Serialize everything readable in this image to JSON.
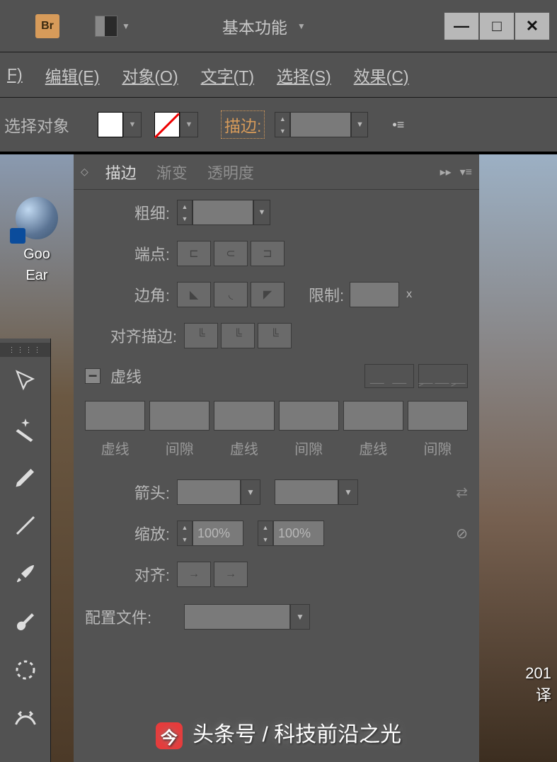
{
  "titlebar": {
    "bridge_label": "Br",
    "workspace_label": "基本功能"
  },
  "menu": {
    "edit": "编辑(E)",
    "object": "对象(O)",
    "type": "文字(T)",
    "select": "选择(S)",
    "effect": "效果(C)"
  },
  "optbar": {
    "select_label": "选择对象",
    "stroke_label": "描边:"
  },
  "panel": {
    "tabs": {
      "stroke": "描边",
      "gradient": "渐变",
      "transparency": "透明度"
    },
    "weight_label": "粗细:",
    "cap_label": "端点:",
    "corner_label": "边角:",
    "limit_label": "限制:",
    "limit_suffix": "x",
    "align_stroke_label": "对齐描边:",
    "dashed_label": "虚线",
    "dash_cols": [
      "虚线",
      "间隙",
      "虚线",
      "间隙",
      "虚线",
      "间隙"
    ],
    "arrow_label": "箭头:",
    "scale_label": "缩放:",
    "scale1": "100%",
    "scale2": "100%",
    "align_label": "对齐:",
    "profile_label": "配置文件:"
  },
  "desktop": {
    "icon_label": "Google Earth",
    "right_year": "201",
    "right_text": "译"
  },
  "watermark": "头条号 / 科技前沿之光"
}
